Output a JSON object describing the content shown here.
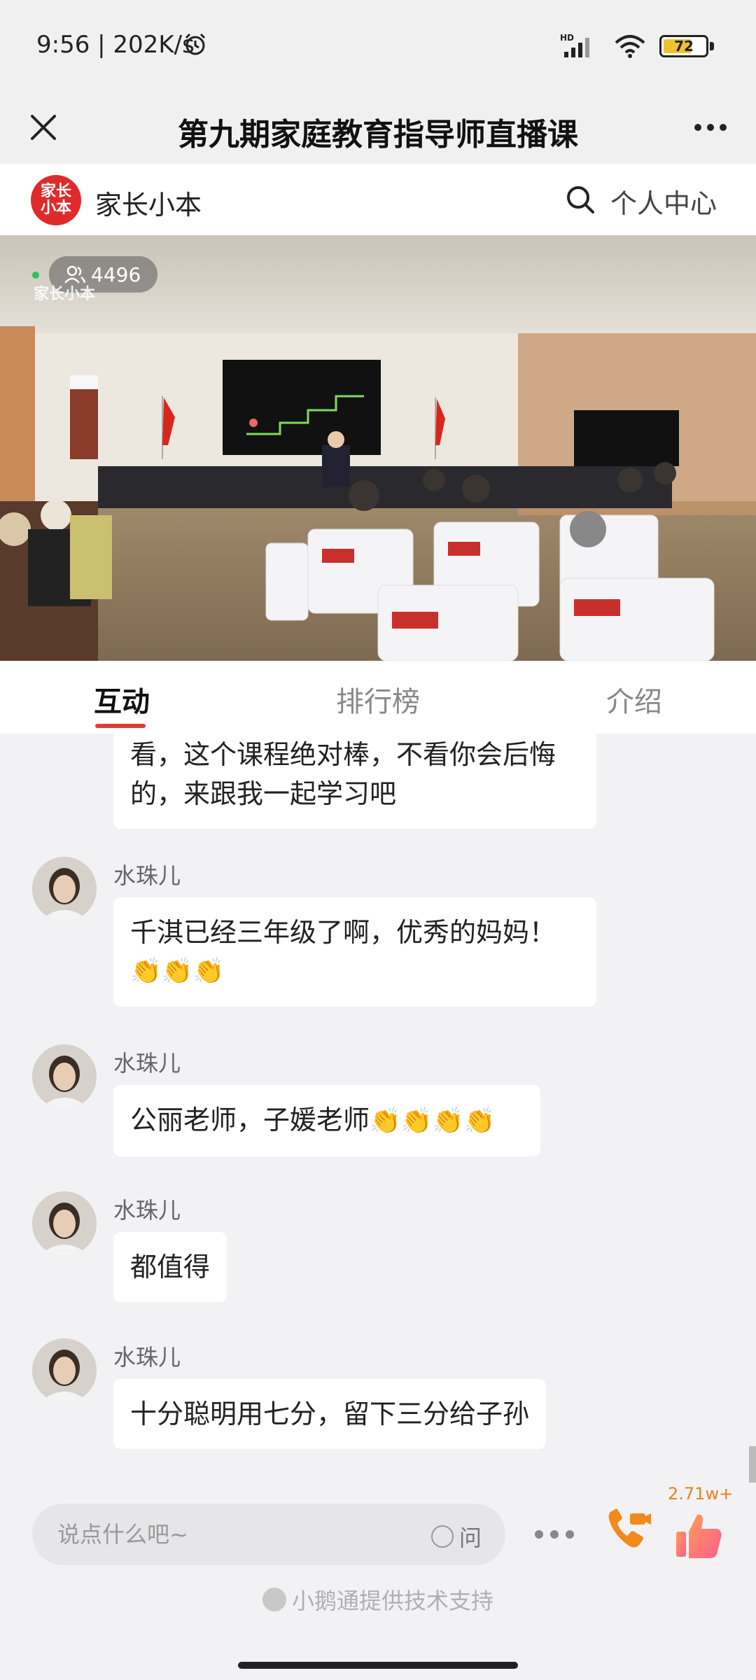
{
  "status_bar": {
    "time_speed": "9:56 | 202K/s",
    "network_label": "HD",
    "battery_level": "72",
    "battery_fraction": 0.72
  },
  "title_bar": {
    "title": "第九期家庭教育指导师直播课",
    "close_icon": "close-icon",
    "more_icon": "more-dots-icon"
  },
  "channel": {
    "logo_text_line1": "家长",
    "logo_text_line2": "小本",
    "name": "家长小本",
    "personal_center": "个人中心",
    "search_icon": "search-icon"
  },
  "video": {
    "viewer_count": "4496",
    "watermark": "家长小本"
  },
  "tabs": [
    {
      "label": "互动",
      "active": true
    },
    {
      "label": "排行榜",
      "active": false
    },
    {
      "label": "介绍",
      "active": false
    }
  ],
  "messages": [
    {
      "sender": "",
      "text_line1": "看，这个课程绝对棒，不看你会后悔",
      "text_line2": "的，来跟我一起学习吧"
    },
    {
      "sender": "水珠儿",
      "text_line1": "千淇已经三年级了啊，优秀的妈妈！",
      "emoji": "👏👏👏"
    },
    {
      "sender": "水珠儿",
      "text": "公丽老师，子媛老师",
      "emoji": "👏👏👏👏"
    },
    {
      "sender": "水珠儿",
      "text": "都值得"
    },
    {
      "sender": "水珠儿",
      "text": "十分聪明用七分，留下三分给子孙"
    }
  ],
  "input": {
    "placeholder": "说点什么吧~",
    "ask_label": "问"
  },
  "like_count": "2.71w+",
  "tech_support": "小鹅通提供技术支持",
  "colors": {
    "accent": "#e23a3a",
    "like_count": "#e8821e",
    "call_icon": "#f08a1c"
  }
}
